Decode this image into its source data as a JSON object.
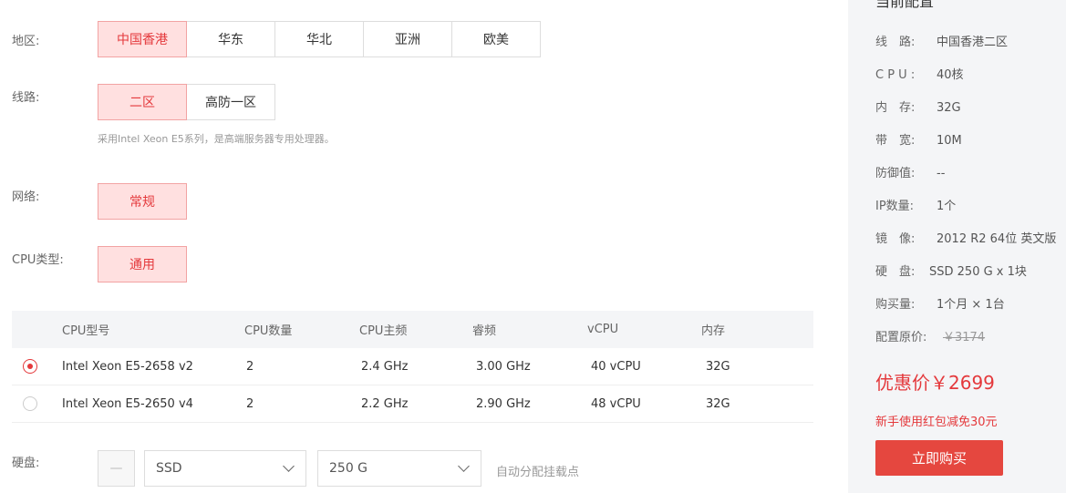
{
  "region": {
    "label": "地区:",
    "options": [
      "中国香港",
      "华东",
      "华北",
      "亚洲",
      "欧美"
    ],
    "selected": "中国香港"
  },
  "line": {
    "label": "线路:",
    "options": [
      "二区",
      "高防一区"
    ],
    "selected": "二区",
    "hint": "采用Intel Xeon E5系列，是高端服务器专用处理器。"
  },
  "network": {
    "label": "网络:",
    "options": [
      "常规"
    ],
    "selected": "常规"
  },
  "cpu_type": {
    "label": "CPU类型:",
    "options": [
      "通用"
    ],
    "selected": "通用"
  },
  "cpu_table": {
    "headers": [
      "CPU型号",
      "CPU数量",
      "CPU主频",
      "睿频",
      "vCPU",
      "内存"
    ],
    "rows": [
      {
        "selected": true,
        "model": "Intel Xeon E5-2658 v2",
        "count": "2",
        "freq": "2.4 GHz",
        "turbo": "3.00 GHz",
        "vcpu": "40 vCPU",
        "mem": "32G"
      },
      {
        "selected": false,
        "model": "Intel Xeon E5-2650 v4",
        "count": "2",
        "freq": "2.2 GHz",
        "turbo": "2.90 GHz",
        "vcpu": "48 vCPU",
        "mem": "32G"
      }
    ]
  },
  "disk": {
    "label": "硬盘:",
    "minus": "—",
    "type_value": "SSD",
    "size_value": "250 G",
    "auto_text": "自动分配挂载点"
  },
  "summary": {
    "title": "当前配置",
    "specs": [
      {
        "key": "线　路:",
        "value": "中国香港二区"
      },
      {
        "key": "C P U :",
        "value": "40核"
      },
      {
        "key": "内　存:",
        "value": "32G"
      },
      {
        "key": "带　宽:",
        "value": "10M"
      },
      {
        "key": "防御值:",
        "value": "--"
      },
      {
        "key": "IP数量:",
        "value": "1个"
      },
      {
        "key": "镜　像:",
        "value": "2012 R2 64位 英文版"
      },
      {
        "key": "硬　盘:",
        "value": "SSD  250 G x 1块"
      },
      {
        "key": "购买量:",
        "value": "1个月 × 1台"
      },
      {
        "key": "配置原价:",
        "value": "￥3174"
      }
    ],
    "price": "优惠价￥2699",
    "promo": "新手使用红包减免30元",
    "buy_label": "立即购买"
  },
  "colors": {
    "accent": "#e4393c",
    "selected_bg": "#ffe0e0",
    "sidebar_bg": "#f4f5f7",
    "buy_button": "#e5473f"
  }
}
